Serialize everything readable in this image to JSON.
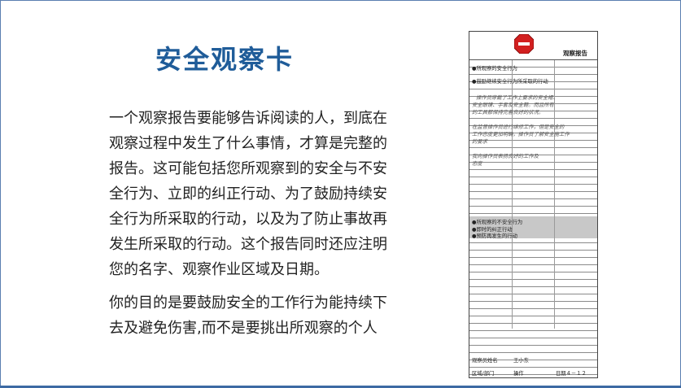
{
  "slide": {
    "title": "安全观察卡",
    "paragraph1": "一个观察报告要能够告诉阅读的人，到底在观察过程中发生了什么事情，才算是完整的报告。这可能包括您所观察到的安全与不安全行为、立即的纠正行动、为了鼓励持续安全行为所采取的行动，以及为了防止事故再发生所采取的行动。这个报告同时还应注明您的名字、观察作业区域及日期。",
    "paragraph2": "你的目的是要鼓励安全的工作行为能持续下去及避免伤害,而不是要挑出所观察的个人"
  },
  "card": {
    "header_title": "观察报告",
    "stop_icon": "stop-sign-icon",
    "lines": [
      "●所观察的安全行为",
      "●鼓励继续安全行为所采取的行动",
      "操作员穿戴了工作上要求的安全帽、",
      "安全眼镜、手套及安全鞋。而且所有",
      "的工具都保持完善良好的状况。",
      "在监督操作员进行维修工作，但是安全的",
      "工作态度更加明确，操作员了解安全施工作",
      "的要求",
      "我向操作员表扬良好的工作及",
      "态度"
    ],
    "unsafe_lines": [
      "●所观察的不安全行为",
      "●即时的纠正行动",
      "●预防再发生的行动"
    ],
    "footer": {
      "observer_label": "观察员姓名",
      "observer_value": "王小东",
      "area_label": "区域/部门",
      "area_value": "操作",
      "date_value": "日期４－１２"
    }
  },
  "colors": {
    "title": "#1f5c99",
    "frame": "#5b7fb0",
    "grey_block": "#c8c8c8",
    "stop_red": "#d22020"
  }
}
